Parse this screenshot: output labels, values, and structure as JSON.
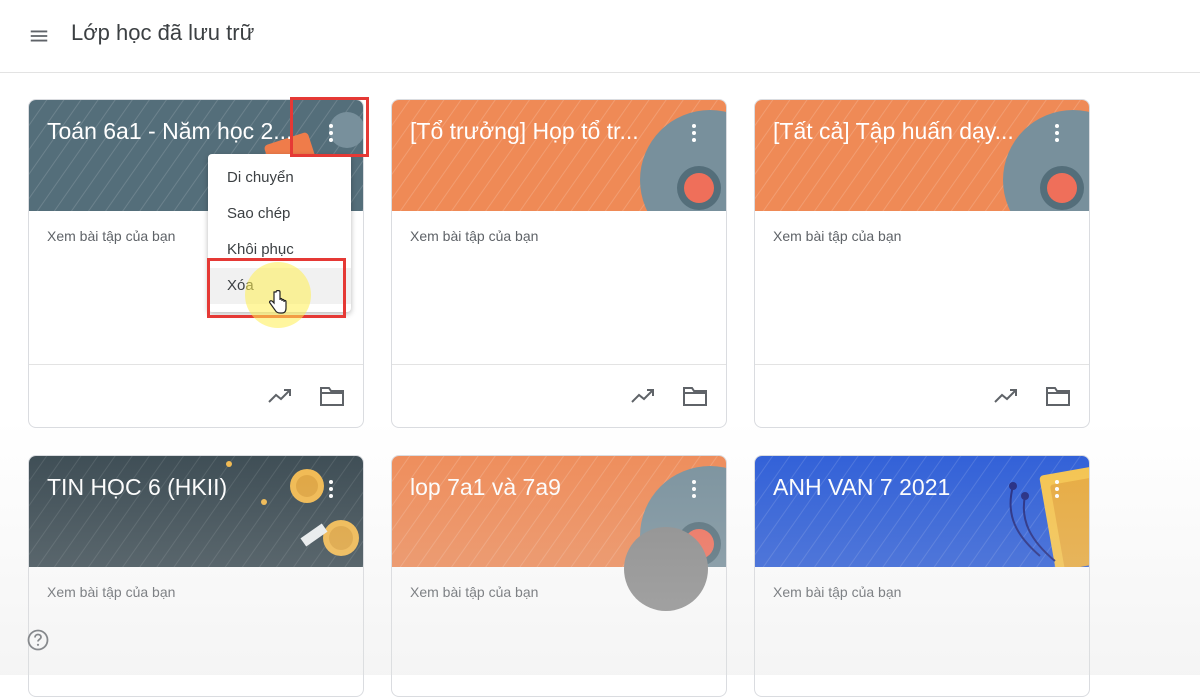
{
  "header": {
    "title": "Lớp học đã lưu trữ"
  },
  "cards": [
    {
      "title": "Toán 6a1 - Năm học 2...",
      "subtitle": "Xem bài tập của bạn"
    },
    {
      "title": "[Tổ trưởng] Họp tổ tr...",
      "subtitle": "Xem bài tập của bạn"
    },
    {
      "title": "[Tất cả] Tập huấn dạy...",
      "subtitle": "Xem bài tập của bạn"
    },
    {
      "title": "TIN HỌC 6 (HKII)",
      "subtitle": "Xem bài tập của bạn"
    },
    {
      "title": "lop 7a1 và 7a9",
      "subtitle": "Xem bài tập của bạn"
    },
    {
      "title": "ANH VAN 7 2021",
      "subtitle": "Xem bài tập của bạn"
    }
  ],
  "context_menu": {
    "items": [
      "Di chuyển",
      "Sao chép",
      "Khôi phục",
      "Xóa"
    ]
  },
  "colors": {
    "slate": "#546e7a",
    "orange": "#ef8a56",
    "dark": "#37474f",
    "blue": "#2a5bd7",
    "highlight": "#e53935"
  },
  "icons": [
    "menu-icon",
    "more-vert-icon",
    "trending-up-icon",
    "folder-icon",
    "help-icon",
    "hand-cursor-icon"
  ]
}
